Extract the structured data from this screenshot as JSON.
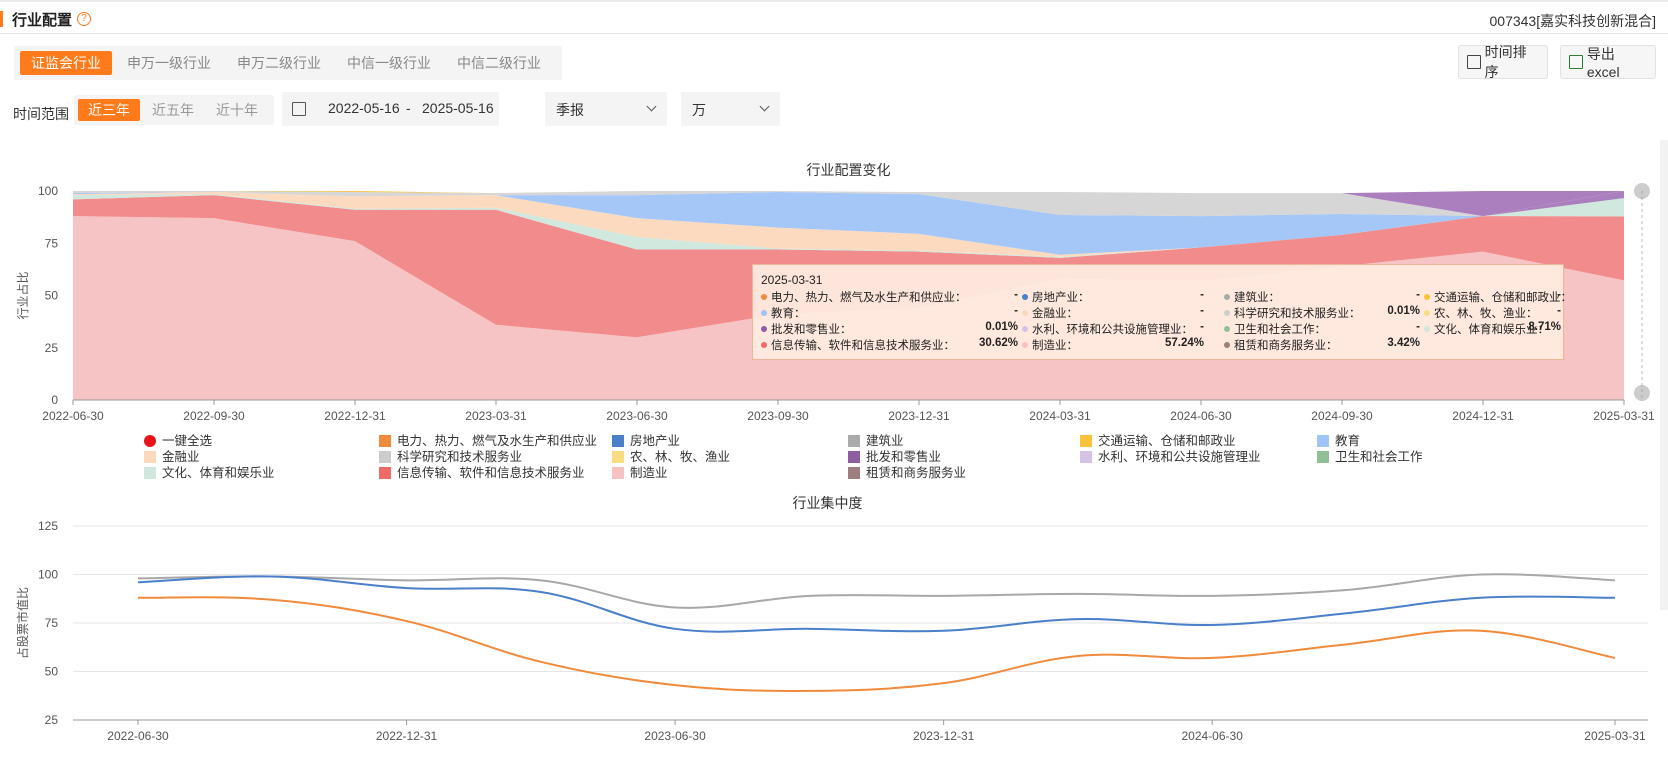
{
  "header": {
    "title": "行业配置",
    "fund_name": "007343[嘉实科技创新混合]"
  },
  "tabs": [
    "证监会行业",
    "申万一级行业",
    "申万二级行业",
    "中信一级行业",
    "中信二级行业"
  ],
  "active_tab": 0,
  "buttons": {
    "time_sort": "时间排序",
    "export": "导出excel"
  },
  "filters": {
    "range_label": "时间范围",
    "ranges": [
      "近三年",
      "近五年",
      "近十年"
    ],
    "active_range": 0,
    "date_start": "2022-05-16",
    "date_sep": "-",
    "date_end": "2025-05-16",
    "period": "季报",
    "unit": "万"
  },
  "colors": {
    "accent": "#ff7a1a",
    "manufacturing": "#f5c1c1",
    "it": "#f08586",
    "culture": "#cfe7dd",
    "finance": "#fcd8bc",
    "education": "#9fc4f8",
    "science": "#d4d4d4",
    "wholesale": "#a678bb",
    "transport": "#f9c23a",
    "line_top": "#a8a8a8",
    "line_mid": "#4a7fca",
    "line_low": "#f08a3c"
  },
  "chart_data": [
    {
      "type": "area",
      "title": "行业配置变化",
      "ylabel": "行业占比",
      "ylim": [
        0,
        100
      ],
      "yticks": [
        0,
        25,
        50,
        75,
        100
      ],
      "x": [
        "2022-06-30",
        "2022-09-30",
        "2022-12-31",
        "2023-03-31",
        "2023-06-30",
        "2023-09-30",
        "2023-12-31",
        "2024-03-31",
        "2024-06-30",
        "2024-09-30",
        "2024-12-31",
        "2025-03-31"
      ],
      "stacked": true,
      "series": [
        {
          "name": "制造业",
          "color_key": "manufacturing",
          "values": [
            88,
            87,
            76,
            36,
            30,
            41,
            44,
            58,
            57,
            64,
            71,
            57.24
          ]
        },
        {
          "name": "信息传输、软件和信息技术服务业",
          "color_key": "it",
          "values": [
            8,
            11,
            15,
            55,
            42,
            31,
            27,
            10,
            16,
            15,
            17,
            30.62
          ]
        },
        {
          "name": "文化、体育和娱乐业",
          "color_key": "culture",
          "values": [
            2,
            0.5,
            0.5,
            1,
            6,
            0.5,
            0.5,
            0.5,
            0,
            0,
            0,
            8.71
          ]
        },
        {
          "name": "租赁和商务服务业",
          "color_key": "wholesale",
          "values": [
            0,
            0,
            0,
            0,
            0,
            0,
            0,
            0,
            0,
            0,
            0,
            3.42
          ]
        },
        {
          "name": "金融业",
          "color_key": "finance",
          "values": [
            0.5,
            1,
            6,
            6,
            9,
            10,
            8,
            1,
            0,
            0,
            0,
            0
          ]
        },
        {
          "name": "教育",
          "color_key": "education",
          "values": [
            0.5,
            0,
            0,
            0,
            11,
            17,
            19,
            19,
            15,
            10,
            0,
            0
          ]
        },
        {
          "name": "科学研究和技术服务业",
          "color_key": "science",
          "values": [
            1,
            0.5,
            2,
            1,
            2,
            0.5,
            1,
            11,
            11,
            10,
            0,
            0.01
          ]
        },
        {
          "name": "批发和零售业",
          "color_key": "wholesale",
          "values": [
            0,
            0,
            0,
            0,
            0,
            0,
            0,
            0,
            0,
            0,
            12,
            0.01
          ]
        },
        {
          "name": "交通运输、仓储和邮政业",
          "color_key": "transport",
          "values": [
            0,
            0,
            1,
            0,
            0,
            0,
            0,
            0,
            0,
            0,
            0,
            0
          ]
        }
      ],
      "tooltip": {
        "date": "2025-03-31",
        "items": [
          {
            "name": "电力、热力、燃气及水生产和供应业：",
            "value": "-",
            "color": "#f08a3c"
          },
          {
            "name": "房地产业：",
            "value": "-",
            "color": "#4a7fca"
          },
          {
            "name": "建筑业：",
            "value": "-",
            "color": "#aaaaaa"
          },
          {
            "name": "交通运输、仓储和邮政业：",
            "value": "-",
            "color": "#f9c23a"
          },
          {
            "name": "教育：",
            "value": "-",
            "color": "#9fc4f8"
          },
          {
            "name": "金融业：",
            "value": "-",
            "color": "#fcd8bc"
          },
          {
            "name": "科学研究和技术服务业：",
            "value": "0.01%",
            "color": "#cccccc"
          },
          {
            "name": "农、林、牧、渔业：",
            "value": "-",
            "color": "#f9dc80"
          },
          {
            "name": "批发和零售业：",
            "value": "0.01%",
            "color": "#8e5ea2"
          },
          {
            "name": "水利、环境和公共设施管理业：",
            "value": "-",
            "color": "#d6c2e5"
          },
          {
            "name": "卫生和社会工作：",
            "value": "-",
            "color": "#8fbf95"
          },
          {
            "name": "文化、体育和娱乐业：",
            "value": "8.71%",
            "color": "#cfe7dd"
          },
          {
            "name": "信息传输、软件和信息技术服务业：",
            "value": "30.62%",
            "color": "#f06a6a"
          },
          {
            "name": "制造业：",
            "value": "57.24%",
            "color": "#f5c1c1"
          },
          {
            "name": "租赁和商务服务业：",
            "value": "3.42%",
            "color": "#9e7e7e"
          }
        ]
      },
      "legend": [
        {
          "name": "一键全选",
          "color": "#e8121b",
          "round": true
        },
        {
          "name": "电力、热力、燃气及水生产和供应业",
          "color": "#f08a3c"
        },
        {
          "name": "房地产业",
          "color": "#4a7fca"
        },
        {
          "name": "建筑业",
          "color": "#aaaaaa"
        },
        {
          "name": "交通运输、仓储和邮政业",
          "color": "#f9c23a"
        },
        {
          "name": "教育",
          "color": "#9fc4f8"
        },
        {
          "name": "金融业",
          "color": "#fcd8bc"
        },
        {
          "name": "科学研究和技术服务业",
          "color": "#cccccc"
        },
        {
          "name": "农、林、牧、渔业",
          "color": "#f9dc80"
        },
        {
          "name": "批发和零售业",
          "color": "#8e5ea2"
        },
        {
          "name": "水利、环境和公共设施管理业",
          "color": "#d6c2e5"
        },
        {
          "name": "卫生和社会工作",
          "color": "#8fbf95"
        },
        {
          "name": "文化、体育和娱乐业",
          "color": "#cfe7dd"
        },
        {
          "name": "信息传输、软件和信息技术服务业",
          "color": "#f06a6a"
        },
        {
          "name": "制造业",
          "color": "#f5c1c1"
        },
        {
          "name": "租赁和商务服务业",
          "color": "#9e7e7e"
        }
      ]
    },
    {
      "type": "line",
      "title": "行业集中度",
      "ylabel": "占股票市值比",
      "ylim": [
        25,
        125
      ],
      "yticks": [
        25,
        50,
        75,
        100,
        125
      ],
      "x": [
        "2022-06-30",
        "2022-09-30",
        "2022-12-31",
        "2023-03-31",
        "2023-06-30",
        "2023-09-30",
        "2023-12-31",
        "2024-03-31",
        "2024-06-30",
        "2024-09-30",
        "2024-12-31",
        "2025-03-31"
      ],
      "xticks": [
        "2022-06-30",
        "2022-12-31",
        "2023-06-30",
        "2023-12-31",
        "2024-06-30",
        "2025-03-31"
      ],
      "series": [
        {
          "color_key": "line_top",
          "values": [
            98,
            99,
            97,
            97,
            83,
            89,
            89,
            90,
            89,
            92,
            100,
            97
          ]
        },
        {
          "color_key": "line_mid",
          "values": [
            96,
            99,
            93,
            91,
            72,
            72,
            71,
            77,
            74,
            80,
            88,
            88
          ]
        },
        {
          "color_key": "line_low",
          "values": [
            88,
            87,
            76,
            55,
            43,
            40,
            44,
            58,
            57,
            64,
            71,
            57
          ]
        }
      ]
    }
  ]
}
